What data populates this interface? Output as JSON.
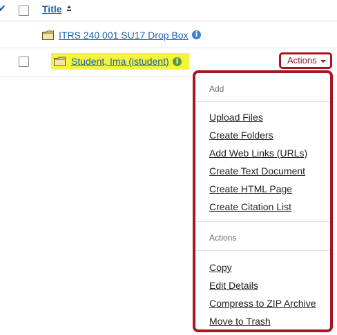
{
  "table": {
    "title_header": "Title",
    "rows": [
      {
        "name": "ITRS 240 001 SU17 Drop Box"
      },
      {
        "name": "Student, Ima (istudent)",
        "actions_label": "Actions"
      }
    ]
  },
  "menu": {
    "add_header": "Add",
    "add_items": [
      "Upload Files",
      "Create Folders",
      "Add Web Links (URLs)",
      "Create Text Document",
      "Create HTML Page",
      "Create Citation List"
    ],
    "actions_header": "Actions",
    "action_items": [
      "Copy",
      "Edit Details",
      "Compress to ZIP Archive",
      "Move to Trash"
    ]
  },
  "colors": {
    "link": "#1f5fa8",
    "highlight": "#f4f43a",
    "callout_border": "#a8141f",
    "info_blue": "#3f7fd0",
    "info_green": "#5a9a3a"
  },
  "icons": [
    "check-icon",
    "sort-ascending-icon",
    "folder-icon",
    "info-icon",
    "caret-down-icon"
  ]
}
